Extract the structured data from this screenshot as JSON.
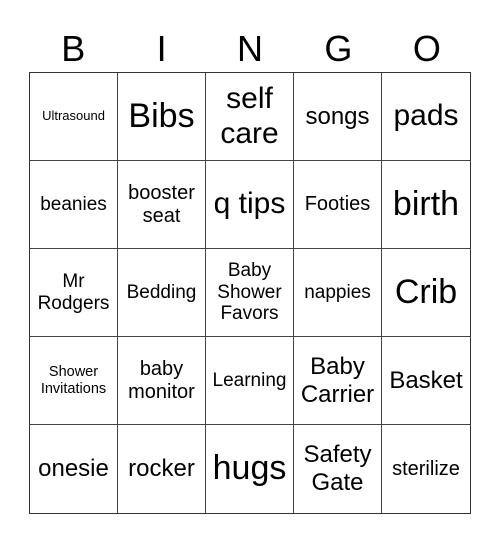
{
  "header": [
    "B",
    "I",
    "N",
    "G",
    "O"
  ],
  "cells": [
    [
      "Ultrasound",
      "Bibs",
      "self care",
      "songs",
      "pads"
    ],
    [
      "beanies",
      "booster seat",
      "q tips",
      "Footies",
      "birth"
    ],
    [
      "Mr Rodgers",
      "Bedding",
      "Baby Shower Favors",
      "nappies",
      "Crib"
    ],
    [
      "Shower Invitations",
      "baby monitor",
      "Learning",
      "Baby Carrier",
      "Basket"
    ],
    [
      "onesie",
      "rocker",
      "hugs",
      "Safety Gate",
      "sterilize"
    ]
  ]
}
